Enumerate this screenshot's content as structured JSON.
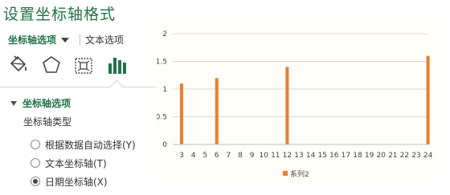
{
  "pane": {
    "title": "设置坐标轴格式",
    "tab_axis_options": "坐标轴选项",
    "tab_text_options": "文本选项",
    "icons": [
      "fill-line-icon",
      "effects-pentagon-icon",
      "size-properties-icon",
      "axis-options-bar-icon"
    ],
    "section_title": "坐标轴选项",
    "axis_type_label": "坐标轴类型",
    "radio_options": [
      {
        "label": "根据数据自动选择(Y)",
        "selected": false
      },
      {
        "label": "文本坐标轴(T)",
        "selected": false
      },
      {
        "label": "日期坐标轴(X)",
        "selected": true
      }
    ],
    "accent_color": "#217346"
  },
  "chart_data": {
    "type": "bar",
    "categories": [
      "3",
      "4",
      "5",
      "6",
      "7",
      "8",
      "9",
      "10",
      "11",
      "12",
      "13",
      "14",
      "15",
      "16",
      "17",
      "18",
      "19",
      "20",
      "21",
      "22",
      "23",
      "24"
    ],
    "series": [
      {
        "name": "系列2",
        "values": [
          1.1,
          null,
          null,
          1.2,
          null,
          null,
          null,
          null,
          null,
          1.4,
          null,
          null,
          null,
          null,
          null,
          null,
          null,
          null,
          null,
          null,
          null,
          1.6
        ],
        "color": "#ed7d31"
      }
    ],
    "ylim": [
      0,
      2
    ],
    "yticks": [
      "0",
      "0.5",
      "1",
      "1.5",
      "2"
    ],
    "grid": true,
    "legend": "bottom",
    "legend_label": "系列2",
    "background_color": "#fefdf8",
    "grid_color": "#d9d9d9"
  }
}
